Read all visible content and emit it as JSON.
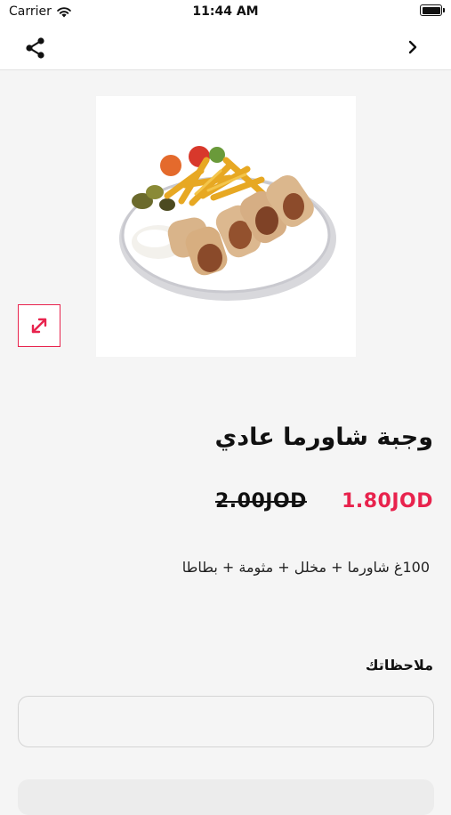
{
  "status_bar": {
    "carrier": "Carrier",
    "time": "11:44 AM",
    "wifi_icon": "wifi-icon",
    "battery_icon": "battery-icon"
  },
  "nav": {
    "share_icon": "share-icon",
    "back_icon": "chevron-right-icon"
  },
  "product": {
    "image_subject": "shawarma plate with fries, pickles and garlic sauce",
    "expand_icon": "expand-diagonal-icon",
    "title": "وجبة شاورما عادي",
    "price": "1.80JOD",
    "old_price": "2.00JOD",
    "description": "100غ شاورما + مخلل + مثومة + بطاطا"
  },
  "notes": {
    "label": "ملاحظاتك",
    "value": "",
    "placeholder": ""
  },
  "colors": {
    "accent": "#e8234d",
    "background": "#f5f5f5"
  }
}
